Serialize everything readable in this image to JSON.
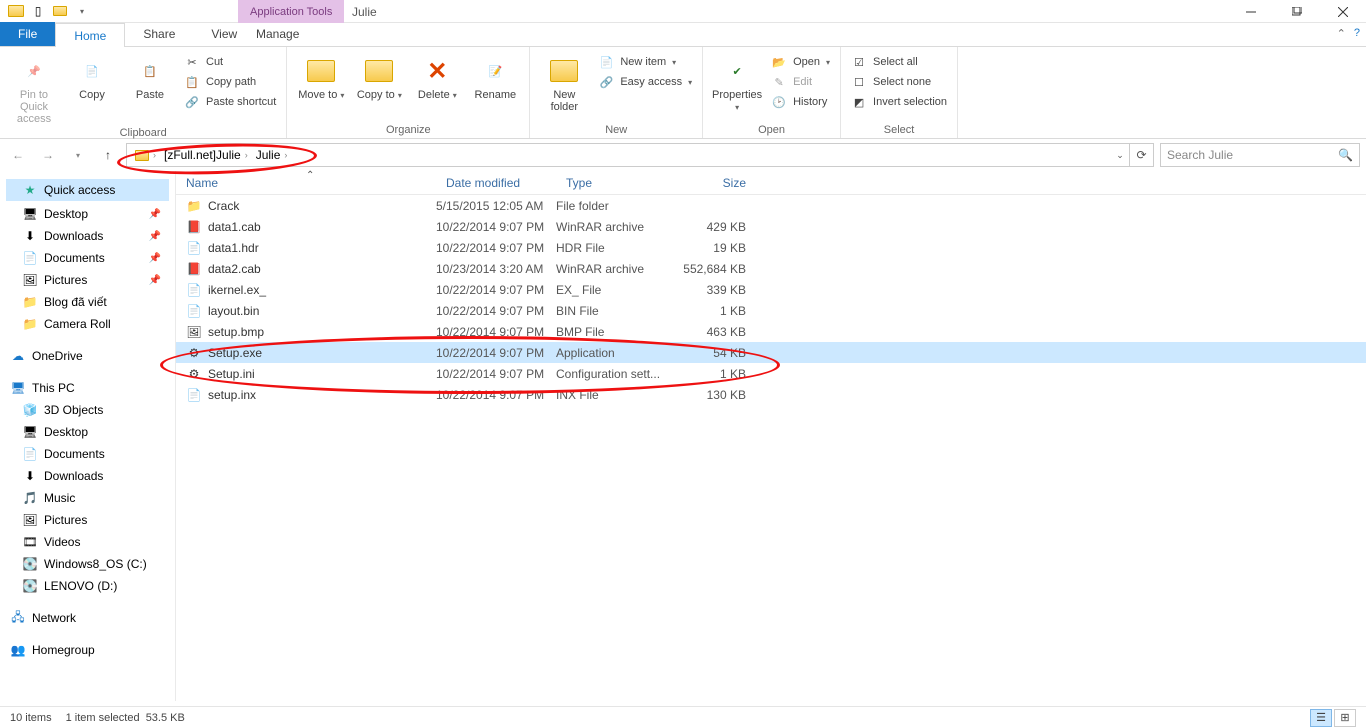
{
  "title": {
    "apptools": "Application Tools",
    "window": "Julie"
  },
  "tabs": {
    "file": "File",
    "home": "Home",
    "share": "Share",
    "view": "View",
    "manage": "Manage"
  },
  "ribbon": {
    "clipboard": {
      "label": "Clipboard",
      "pin": "Pin to Quick access",
      "copy": "Copy",
      "paste": "Paste",
      "cut": "Cut",
      "copypath": "Copy path",
      "pasteshortcut": "Paste shortcut"
    },
    "organize": {
      "label": "Organize",
      "moveto": "Move to",
      "copyto": "Copy to",
      "delete": "Delete",
      "rename": "Rename"
    },
    "new": {
      "label": "New",
      "newfolder": "New folder",
      "newitem": "New item",
      "easyaccess": "Easy access"
    },
    "open": {
      "label": "Open",
      "properties": "Properties",
      "open": "Open",
      "edit": "Edit",
      "history": "History"
    },
    "select": {
      "label": "Select",
      "selectall": "Select all",
      "selectnone": "Select none",
      "invert": "Invert selection"
    }
  },
  "breadcrumb": {
    "a": "[zFull.net]Julie",
    "b": "Julie"
  },
  "search": {
    "placeholder": "Search Julie"
  },
  "columns": {
    "name": "Name",
    "date": "Date modified",
    "type": "Type",
    "size": "Size"
  },
  "nav": {
    "quick": "Quick access",
    "items1": [
      "Desktop",
      "Downloads",
      "Documents",
      "Pictures",
      "Blog đã viết",
      "Camera Roll"
    ],
    "onedrive": "OneDrive",
    "thispc": "This PC",
    "items2": [
      "3D Objects",
      "Desktop",
      "Documents",
      "Downloads",
      "Music",
      "Pictures",
      "Videos",
      "Windows8_OS (C:)",
      "LENOVO (D:)"
    ],
    "network": "Network",
    "homegroup": "Homegroup"
  },
  "files": [
    {
      "name": "Crack",
      "date": "5/15/2015 12:05 AM",
      "type": "File folder",
      "size": "",
      "icon": "folder"
    },
    {
      "name": "data1.cab",
      "date": "10/22/2014 9:07 PM",
      "type": "WinRAR archive",
      "size": "429 KB",
      "icon": "archive"
    },
    {
      "name": "data1.hdr",
      "date": "10/22/2014 9:07 PM",
      "type": "HDR File",
      "size": "19 KB",
      "icon": "file"
    },
    {
      "name": "data2.cab",
      "date": "10/23/2014 3:20 AM",
      "type": "WinRAR archive",
      "size": "552,684 KB",
      "icon": "archive"
    },
    {
      "name": "ikernel.ex_",
      "date": "10/22/2014 9:07 PM",
      "type": "EX_ File",
      "size": "339 KB",
      "icon": "file"
    },
    {
      "name": "layout.bin",
      "date": "10/22/2014 9:07 PM",
      "type": "BIN File",
      "size": "1 KB",
      "icon": "file"
    },
    {
      "name": "setup.bmp",
      "date": "10/22/2014 9:07 PM",
      "type": "BMP File",
      "size": "463 KB",
      "icon": "image"
    },
    {
      "name": "Setup.exe",
      "date": "10/22/2014 9:07 PM",
      "type": "Application",
      "size": "54 KB",
      "icon": "exe",
      "selected": true
    },
    {
      "name": "Setup.ini",
      "date": "10/22/2014 9:07 PM",
      "type": "Configuration sett...",
      "size": "1 KB",
      "icon": "config"
    },
    {
      "name": "setup.inx",
      "date": "10/22/2014 9:07 PM",
      "type": "INX File",
      "size": "130 KB",
      "icon": "file"
    }
  ],
  "status": {
    "items": "10 items",
    "selected": "1 item selected",
    "size": "53.5 KB"
  }
}
